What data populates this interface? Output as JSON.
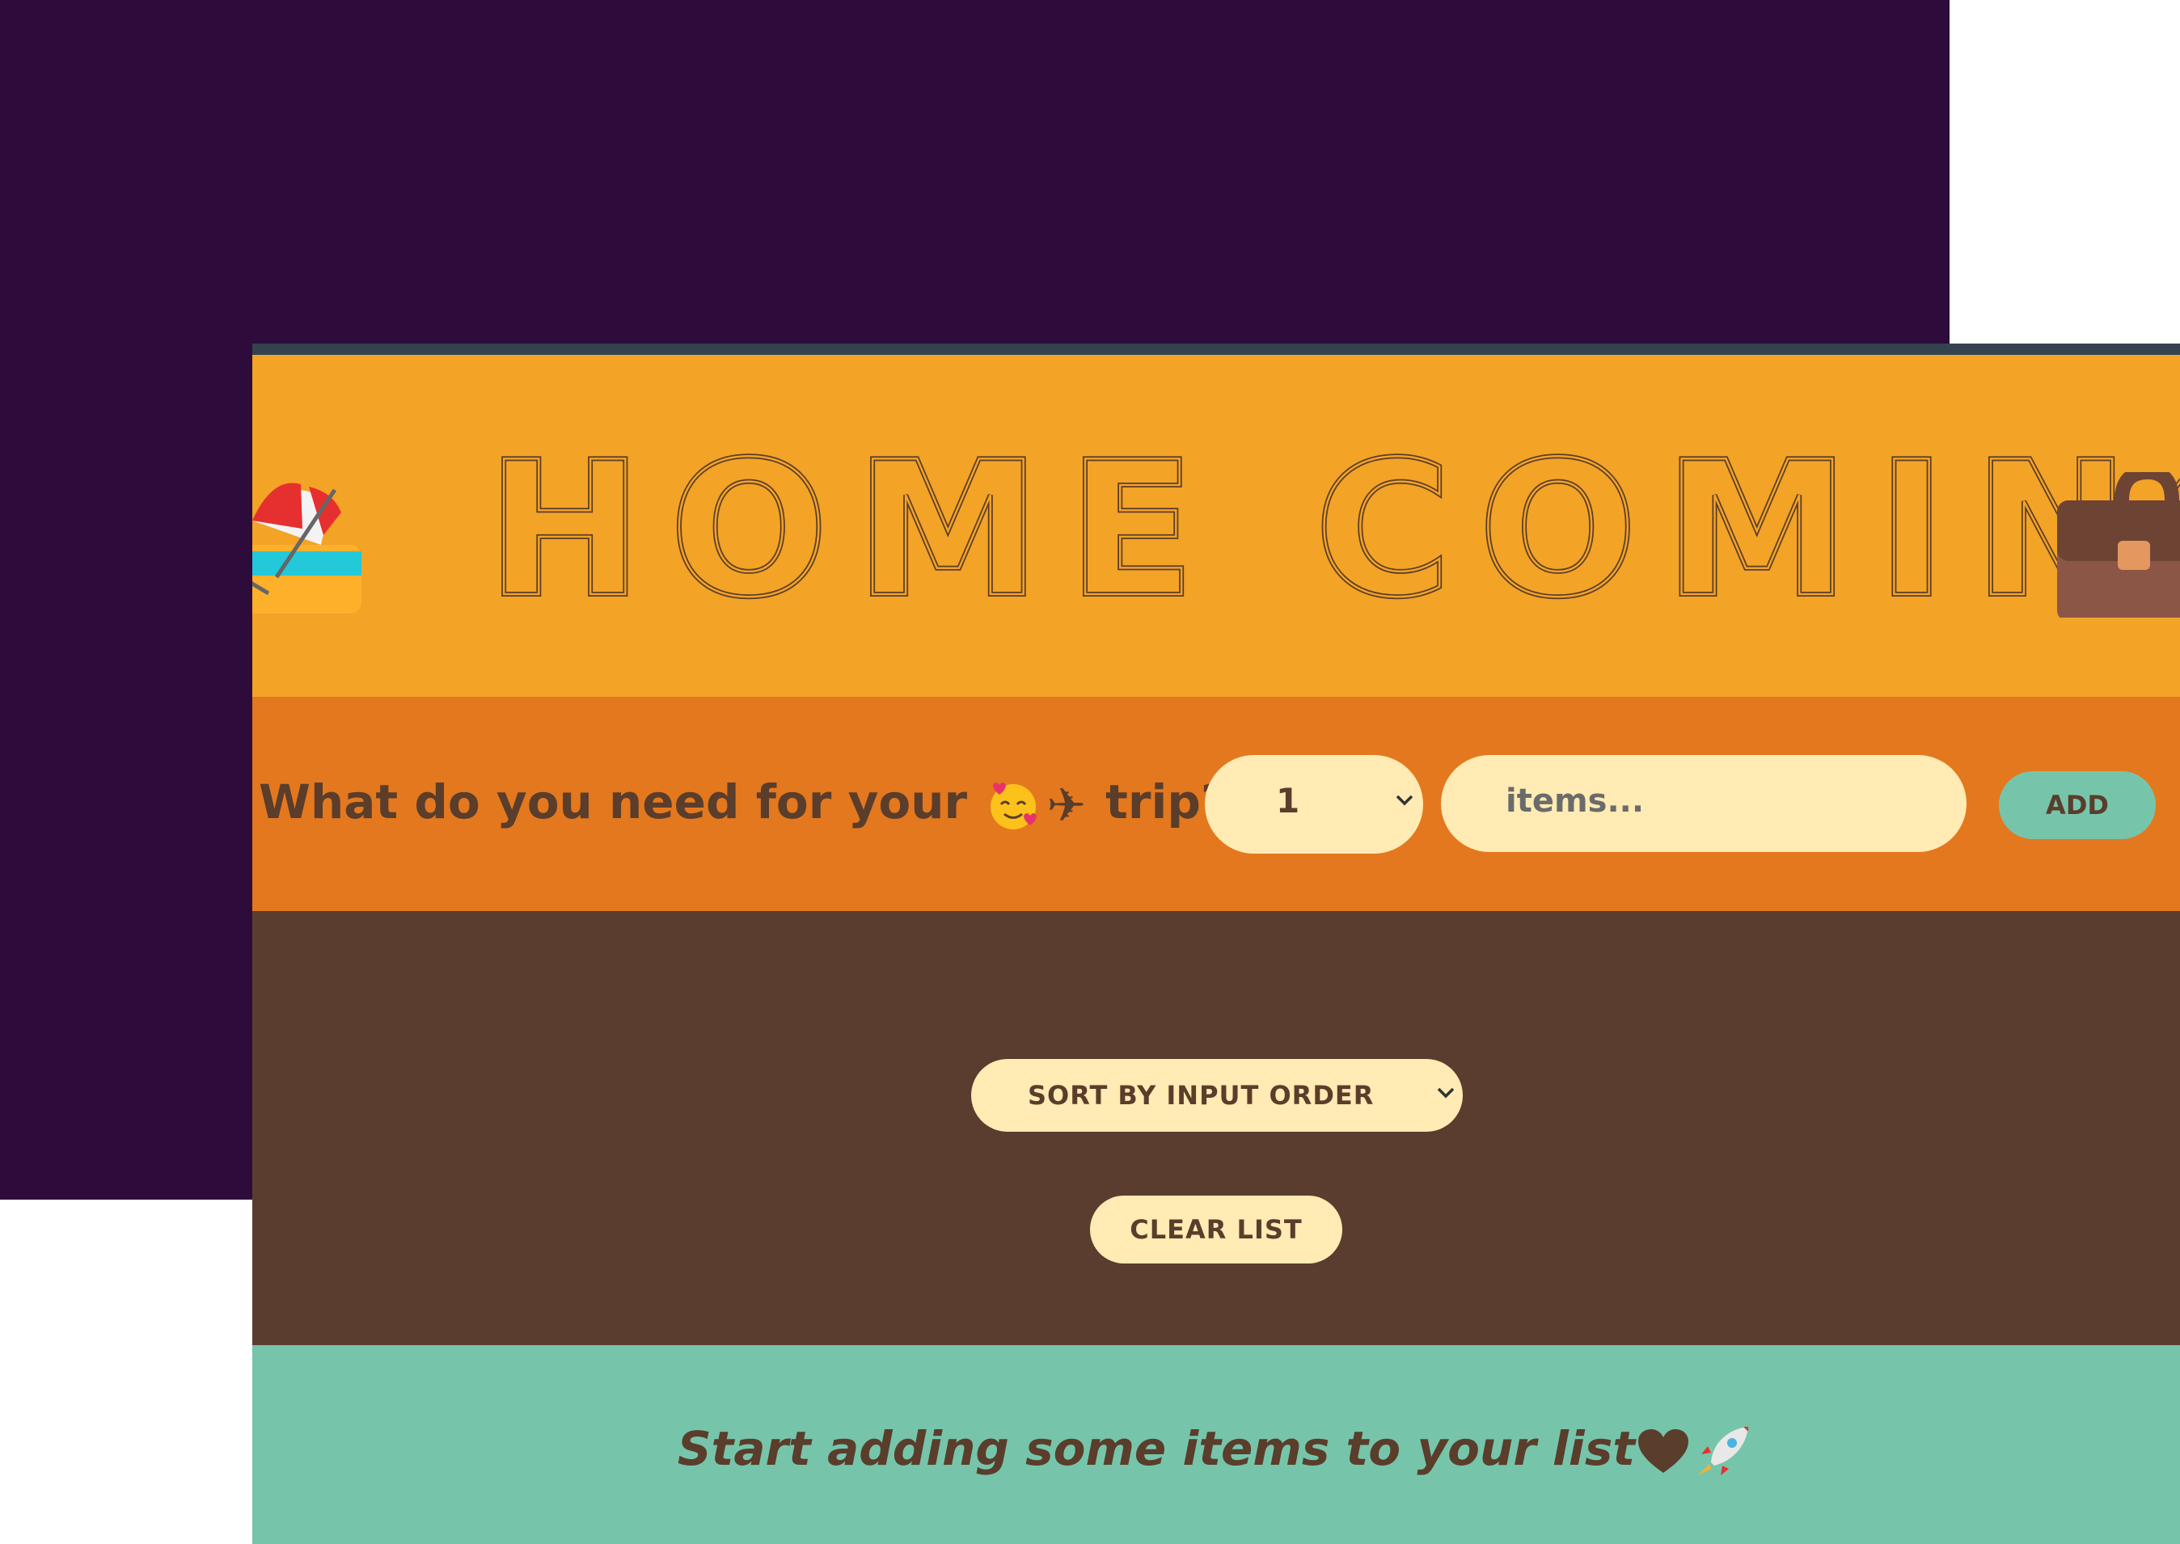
{
  "header": {
    "title": "HOME COMING",
    "left_icon": "beach-umbrella-icon",
    "right_icon": "briefcase-icon"
  },
  "form": {
    "question": "What do you need for your",
    "question_emoji": "smiling-face-with-hearts-icon",
    "question_plane": "✈",
    "question_end": "trip?",
    "quantity_value": "1",
    "items_placeholder": "items...",
    "add_label": "ADD"
  },
  "list": {
    "sort_value": "SORT BY INPUT ORDER",
    "clear_label": "CLEAR LIST"
  },
  "stats": {
    "message": "Start adding some items to your list",
    "heart_icon": "brown-heart-icon",
    "rocket_icon": "rocket-icon"
  },
  "colors": {
    "backdrop": "#2d0c3b",
    "header": "#f3a326",
    "form": "#e4781e",
    "list": "#5a3d2e",
    "stats": "#76c5ab",
    "text_dark": "#5a3d2b",
    "input_bg": "#ffebb3"
  }
}
